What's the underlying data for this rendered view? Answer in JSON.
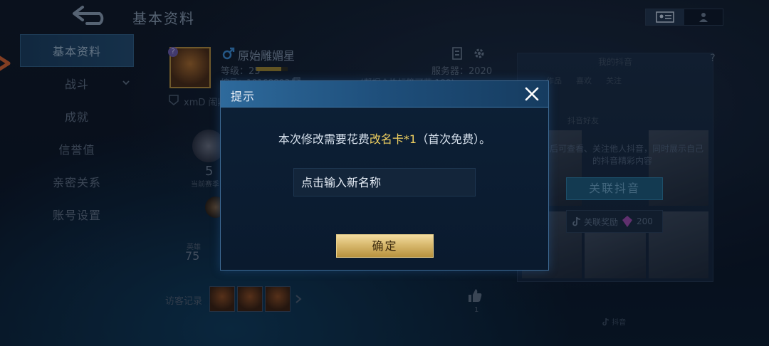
{
  "header": {
    "title": "基本资料"
  },
  "sidebar": {
    "items": [
      {
        "label": "基本资料"
      },
      {
        "label": "战斗"
      },
      {
        "label": "成就"
      },
      {
        "label": "信誉值"
      },
      {
        "label": "亲密关系"
      },
      {
        "label": "账号设置"
      }
    ]
  },
  "profile": {
    "name": "原始雕媚星",
    "level_text": "等级：25",
    "level_progress": 0.8,
    "id_text": "编号：10168893",
    "server_text": "服务器：2020",
    "note_text": "(帮据个性标签可获 100)",
    "guild_text": "xmD 闹鼎",
    "rank_number": "5",
    "rank_label": "当前赛季",
    "stat_label": "英雄",
    "stat_value": "75",
    "visitors_label": "访客记录",
    "like_count": "1"
  },
  "douyin": {
    "header": "我的抖音",
    "tabs": [
      "作品",
      "喜欢",
      "关注"
    ],
    "sub": "抖音好友",
    "desc": "音后可查看、关注他人抖音，同时展示自己的抖音精彩内容",
    "link_button": "关联抖音",
    "reward_label": "关联奖励",
    "reward_value": "200",
    "footer": "抖音"
  },
  "dialog": {
    "title": "提示",
    "message_prefix": "本次修改需要花费",
    "message_highlight": "改名卡*1",
    "message_suffix": "（首次免费）。",
    "input_placeholder": "点击输入新名称",
    "confirm_label": "确定"
  },
  "colors": {
    "accent_gold": "#f0d060",
    "dialog_title_bg": "#2e6a9c",
    "confirm_gold": "#d8b96e"
  }
}
